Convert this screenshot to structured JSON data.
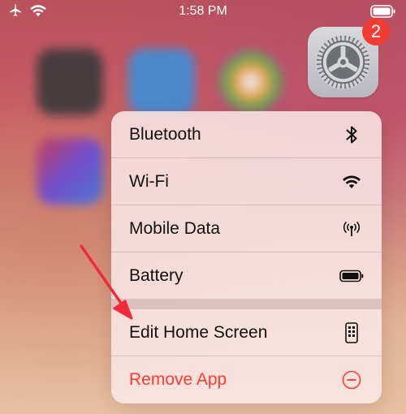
{
  "status_bar": {
    "time": "1:58 PM",
    "airplane_icon": "airplane-icon",
    "wifi_icon": "wifi-icon",
    "battery_icon": "battery-icon"
  },
  "settings_app": {
    "icon": "gear-icon",
    "badge": "2"
  },
  "menu": {
    "items": [
      {
        "label": "Bluetooth",
        "icon": "bluetooth-icon"
      },
      {
        "label": "Wi-Fi",
        "icon": "wifi-icon"
      },
      {
        "label": "Mobile Data",
        "icon": "antenna-icon"
      },
      {
        "label": "Battery",
        "icon": "battery-icon"
      },
      {
        "label": "Edit Home Screen",
        "icon": "phone-apps-icon"
      },
      {
        "label": "Remove App",
        "icon": "minus-circle-icon"
      }
    ]
  },
  "colors": {
    "destructive": "#ff3b30",
    "badge": "#f23b33",
    "annotation_arrow": "#ef2b3a"
  }
}
